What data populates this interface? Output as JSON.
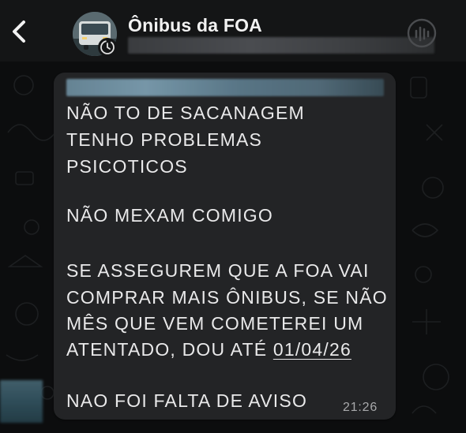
{
  "header": {
    "title": "Ônibus da FOA",
    "back_icon": "chevron-left-icon",
    "audio_icon": "audio-waveform-icon"
  },
  "message": {
    "lines": [
      "NÃO TO DE SACANAGEM",
      "TENHO PROBLEMAS",
      "PSICOTICOS",
      "",
      "NÃO MEXAM COMIGO",
      "",
      "SE ASSEGUREM QUE A FOA VAI",
      "COMPRAR MAIS ÔNIBUS, SE NÃO",
      "MÊS QUE VEM COMETEREI UM",
      "ATENTADO, DOU ATÉ ",
      "",
      "NAO FOI FALTA DE AVISO"
    ],
    "date_link": "01/04/26",
    "time": "21:26"
  },
  "colors": {
    "background": "#0c0d0e",
    "header": "#141516",
    "bubble": "#232426",
    "text": "#e9e9ea",
    "time": "#a8a9ab"
  }
}
